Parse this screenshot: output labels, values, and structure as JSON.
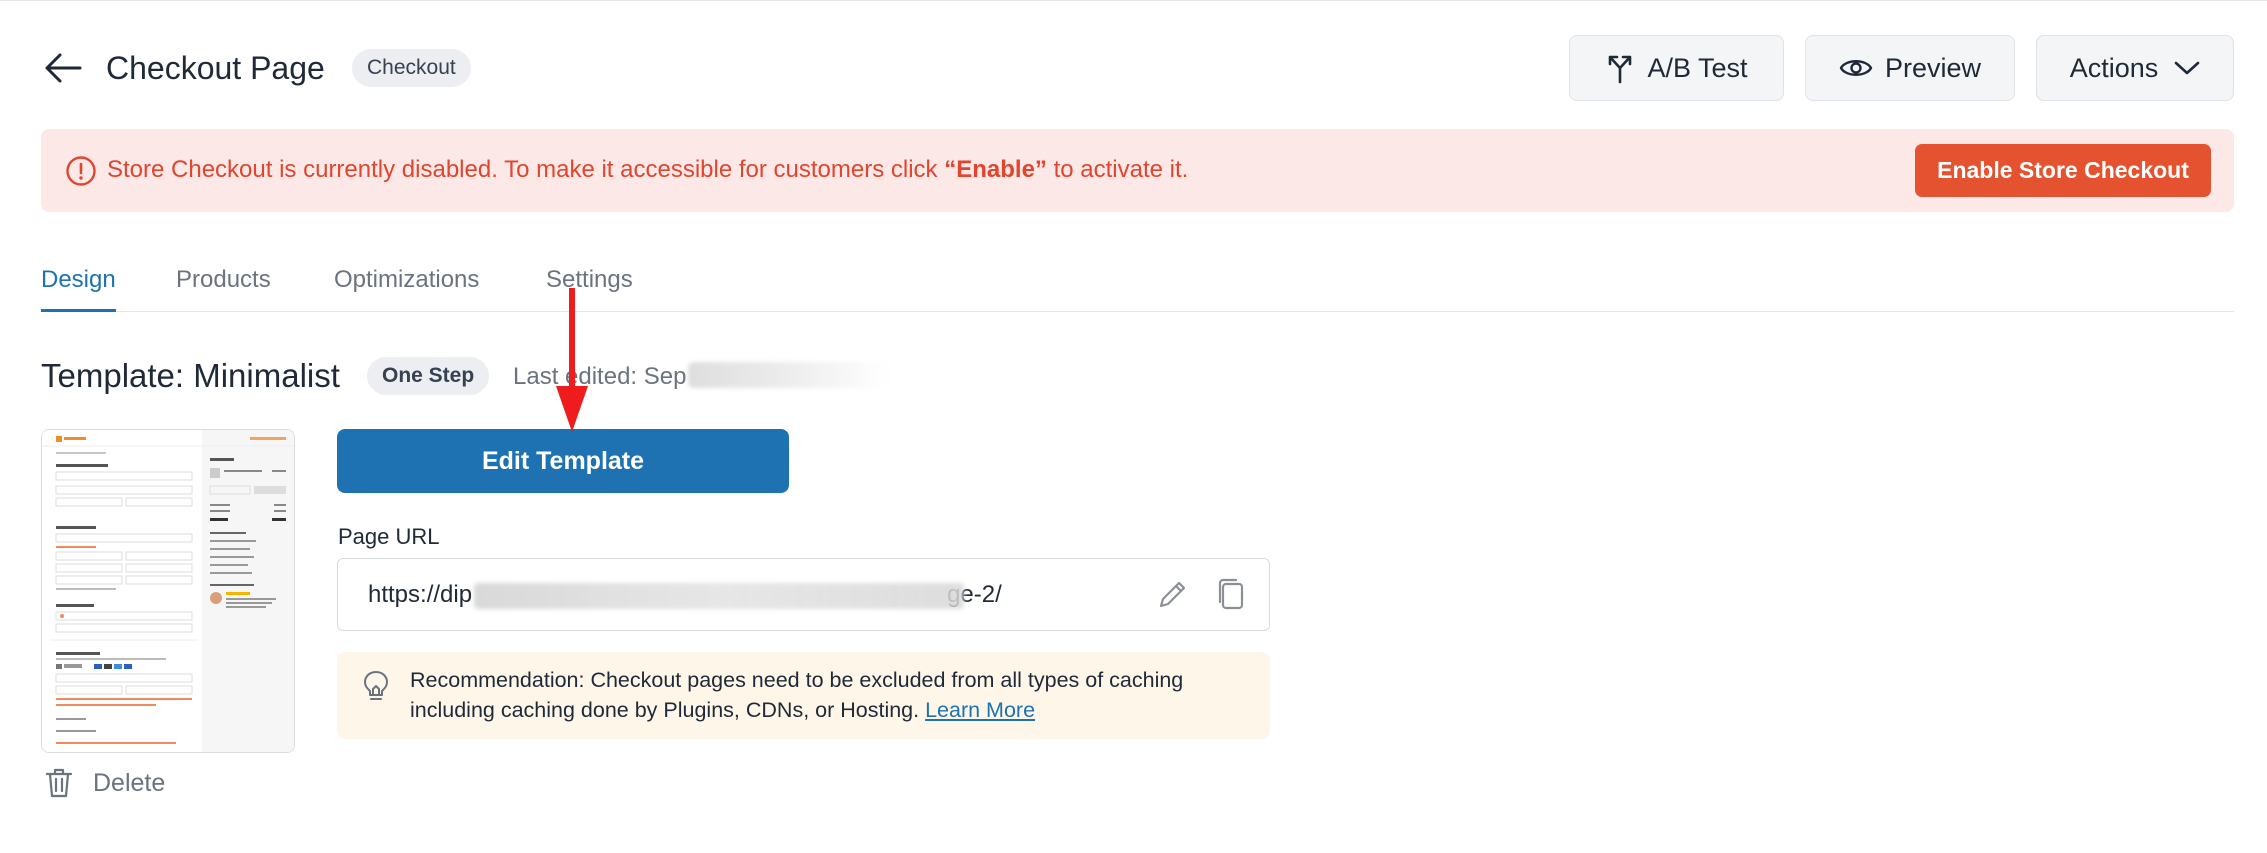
{
  "header": {
    "title": "Checkout Page",
    "type_badge": "Checkout",
    "ab_test_label": "A/B Test",
    "preview_label": "Preview",
    "actions_label": "Actions"
  },
  "alert": {
    "text_before": "Store Checkout is currently disabled. To make it accessible for customers click ",
    "text_emphasis": "“Enable”",
    "text_after": " to activate it.",
    "button_label": "Enable Store Checkout",
    "color": "#e0452d"
  },
  "tabs": [
    {
      "label": "Design",
      "active": true
    },
    {
      "label": "Products",
      "active": false
    },
    {
      "label": "Optimizations",
      "active": false
    },
    {
      "label": "Settings",
      "active": false
    }
  ],
  "template": {
    "title": "Template: Minimalist",
    "step_badge": "One Step",
    "last_edited": "Last edited: Sep",
    "edit_button_label": "Edit Template",
    "delete_label": "Delete"
  },
  "page_url": {
    "label": "Page URL",
    "value_start": "https://dip",
    "value_end": "ge-2/"
  },
  "recommendation": {
    "text": "Recommendation: Checkout pages need to be excluded from all types of caching including caching done by Plugins, CDNs, or Hosting.",
    "link_label": "Learn More"
  },
  "colors": {
    "accent": "#1f72b1",
    "danger": "#e4522f",
    "annotation_arrow": "#ee1c1c"
  },
  "icons": {
    "back": "arrow-left-icon",
    "ab_test": "split-arrows-icon",
    "preview": "eye-icon",
    "actions": "chevron-down-icon",
    "alert": "info-circle-icon",
    "edit": "pencil-icon",
    "copy": "copy-icon",
    "bulb": "lightbulb-icon",
    "delete": "trash-icon"
  }
}
